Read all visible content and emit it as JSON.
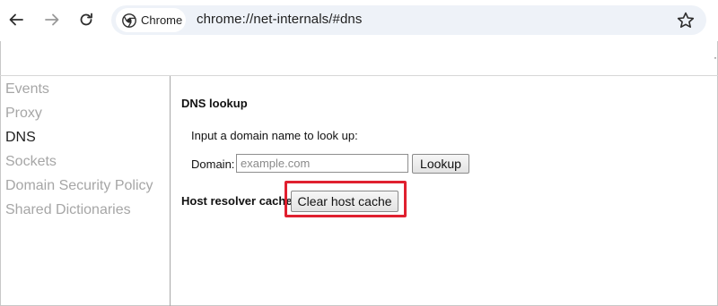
{
  "browser": {
    "chip_label": "Chrome",
    "url": "chrome://net-internals/#dns"
  },
  "sidebar": {
    "items": [
      {
        "label": "Events"
      },
      {
        "label": "Proxy"
      },
      {
        "label": "DNS"
      },
      {
        "label": "Sockets"
      },
      {
        "label": "Domain Security Policy"
      },
      {
        "label": "Shared Dictionaries"
      }
    ],
    "active": "DNS"
  },
  "dns": {
    "lookup_title": "DNS lookup",
    "lookup_prompt": "Input a domain name to look up:",
    "domain_label": "Domain:",
    "domain_value": "",
    "domain_placeholder": "example.com",
    "lookup_button": "Lookup",
    "cache_title": "Host resolver cache",
    "clear_cache_button": "Clear host cache"
  },
  "colors": {
    "highlight": "#e0202f",
    "omnibox_bg": "#eef2f8",
    "inactive_text": "#a6a6a6"
  }
}
